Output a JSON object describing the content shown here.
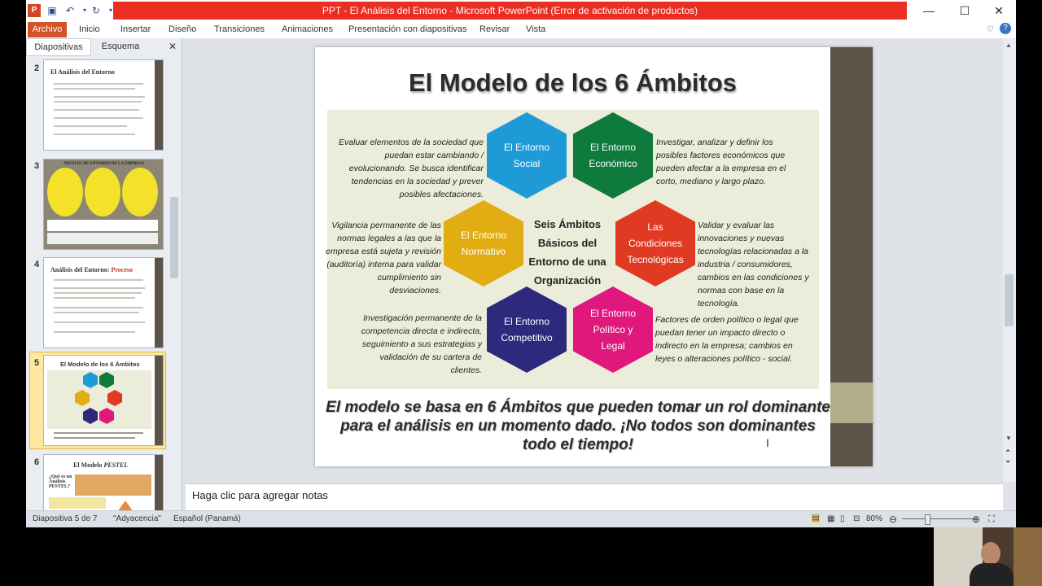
{
  "window": {
    "title": "PPT - El Análisis del Entorno  -  Microsoft PowerPoint (Error de activación de productos)"
  },
  "ribbon": {
    "file_tab": "Archivo",
    "tabs": [
      "Inicio",
      "Insertar",
      "Diseño",
      "Transiciones",
      "Animaciones",
      "Presentación con diapositivas",
      "Revisar",
      "Vista"
    ]
  },
  "panel": {
    "tab_slides": "Diapositivas",
    "tab_outline": "Esquema"
  },
  "thumbnails": [
    {
      "number": "2",
      "title": "El Análisis del Entorno"
    },
    {
      "number": "3",
      "title": "NIVELES DE ENTORNO DE LA EMPRESA"
    },
    {
      "number": "4",
      "title": "Análisis del Entorno:",
      "title_accent": "Proceso"
    },
    {
      "number": "5",
      "title": "El Modelo de los 6 Ámbitos"
    },
    {
      "number": "6",
      "title": "El Modelo",
      "title_accent": "PESTEL",
      "sub": "¿Qué es un Análisis PESTEL?"
    }
  ],
  "slide": {
    "title": "El Modelo de los 6 Ámbitos",
    "center_text": "Seis Ámbitos Básicos del Entorno de una Organización",
    "hexes": {
      "social": "El Entorno Social",
      "economico": "El Entorno Económico",
      "normativo": "El Entorno Normativo",
      "tecnologicas": "Las Condiciones Tecnológicas",
      "competitivo": "El Entorno Competitivo",
      "politico": "El Entorno Político y Legal"
    },
    "descriptions": {
      "social": "Evaluar elementos de la sociedad que puedan estar cambiando / evolucionando. Se busca identificar tendencias en la sociedad y prever posibles afectaciones.",
      "economico": "Investigar, analizar y definir los posibles factores económicos que pueden afectar a la empresa en el corto, mediano y largo plazo.",
      "normativo": "Vigilancia permanente de las normas legales a las que la empresa está sujeta y revisión (auditoría) interna para validar cumplimiento sin desviaciones.",
      "tecnologicas": "Validar y evaluar las innovaciones y nuevas tecnologías relacionadas a la industria / consumidores, cambios en las condiciones y normas con base en la tecnología.",
      "competitivo": "Investigación permanente de la competencia directa e indirecta, seguimiento a sus estrategias y validación de su cartera de clientes.",
      "politico": "Factores de orden político o legal que puedan tener un impacto directo o indirecto en la empresa; cambios en leyes o alteraciones político - social."
    },
    "bottom_text": "El modelo se basa en 6 Ámbitos que pueden tomar un rol dominante para el análisis en un momento dado.  ¡No todos son dominantes todo el tiempo!"
  },
  "notes": {
    "placeholder": "Haga clic para agregar notas"
  },
  "status": {
    "slide_info": "Diapositiva 5 de 7",
    "theme": "\"Adyacencia\"",
    "language": "Español (Panamá)",
    "zoom": "80%"
  },
  "colors": {
    "titlebar_red": "#ea2e21",
    "file_tab": "#d0542a",
    "social": "#1e9bd7",
    "economico": "#0e7a3c",
    "normativo": "#e2ad12",
    "tecnologicas": "#e03b22",
    "competitivo": "#2d2a7e",
    "politico": "#e0187e"
  }
}
